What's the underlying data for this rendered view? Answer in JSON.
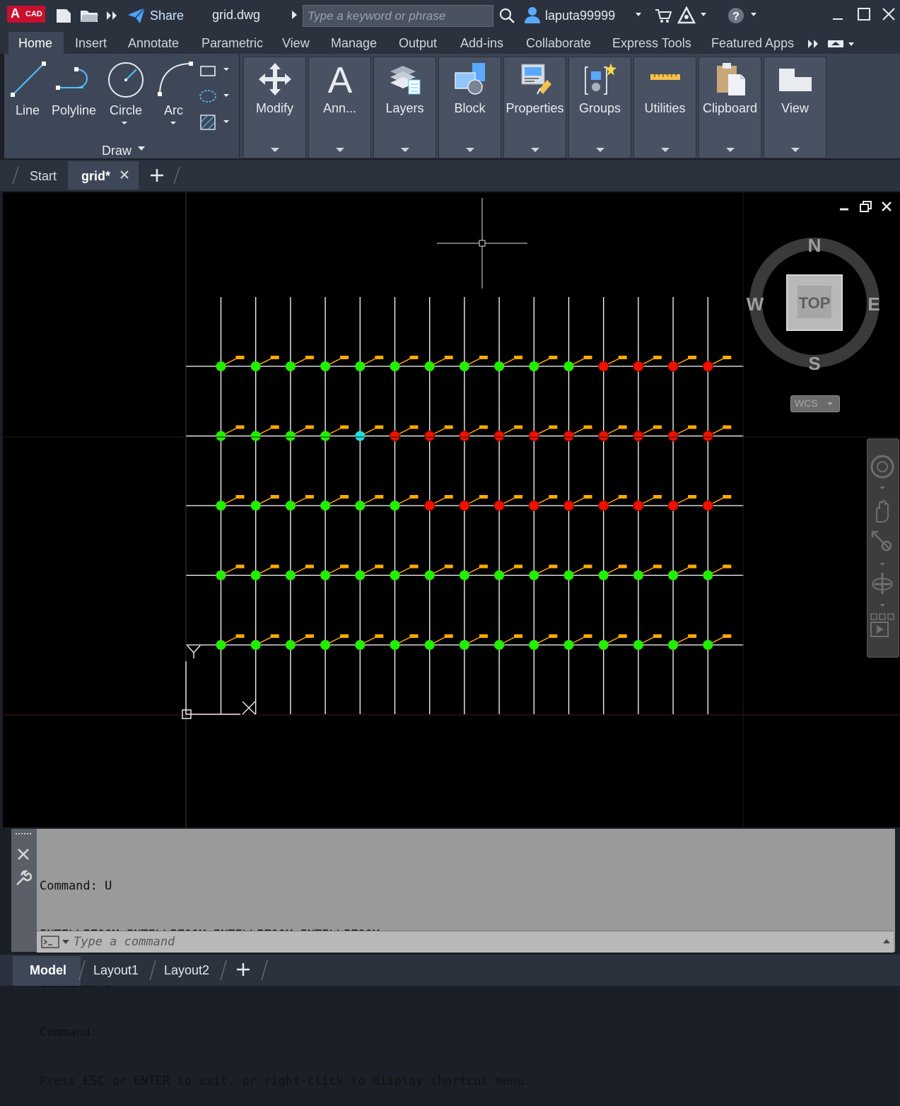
{
  "app": {
    "logo_letter": "A",
    "logo_sub": "CAD",
    "share_label": "Share",
    "file_name": "grid.dwg",
    "search_placeholder": "Type a keyword or phrase",
    "username": "laputa99999",
    "help_label": "?"
  },
  "ribbon_tabs": [
    "Home",
    "Insert",
    "Annotate",
    "Parametric",
    "View",
    "Manage",
    "Output",
    "Add-ins",
    "Collaborate",
    "Express Tools",
    "Featured Apps"
  ],
  "draw_panel": {
    "title": "Draw",
    "tools": [
      "Line",
      "Polyline",
      "Circle",
      "Arc"
    ]
  },
  "ribbon_buttons": [
    "Modify",
    "Ann...",
    "Layers",
    "Block",
    "Properties",
    "Groups",
    "Utilities",
    "Clipboard",
    "View"
  ],
  "file_tabs": {
    "start": "Start",
    "active": "grid*"
  },
  "viewcube": {
    "north": "N",
    "south": "S",
    "east": "E",
    "west": "W",
    "face": "TOP",
    "ucs": "WCS"
  },
  "drawing": {
    "rows": [
      [
        "green",
        "green",
        "green",
        "green",
        "green",
        "green",
        "green",
        "green",
        "green",
        "green",
        "green",
        "red",
        "red",
        "red",
        "red"
      ],
      [
        "green",
        "green",
        "green",
        "green",
        "cyan",
        "red",
        "red",
        "red",
        "red",
        "red",
        "red",
        "red",
        "red",
        "red",
        "red"
      ],
      [
        "green",
        "green",
        "green",
        "green",
        "green",
        "green",
        "red",
        "red",
        "red",
        "red",
        "red",
        "red",
        "red",
        "red",
        "red"
      ],
      [
        "green",
        "green",
        "green",
        "green",
        "green",
        "green",
        "green",
        "green",
        "green",
        "green",
        "green",
        "green",
        "green",
        "green",
        "green"
      ],
      [
        "green",
        "green",
        "green",
        "green",
        "green",
        "green",
        "green",
        "green",
        "green",
        "green",
        "green",
        "green",
        "green",
        "green",
        "green"
      ]
    ],
    "colors": {
      "green": "#22ee00",
      "red": "#ee1100",
      "cyan": "#22dddd",
      "tag": "#ffaa00",
      "line": "#ffffff"
    }
  },
  "command": {
    "history": [
      "Command: U",
      "INTELLIZOOM INTELLIZOOM INTELLIZOOM INTELLIZOOM",
      "Command: U",
      "Command:",
      "Press ESC or ENTER to exit, or right-click to display shortcut menu."
    ],
    "placeholder": "Type a command"
  },
  "layout_tabs": [
    "Model",
    "Layout1",
    "Layout2"
  ]
}
